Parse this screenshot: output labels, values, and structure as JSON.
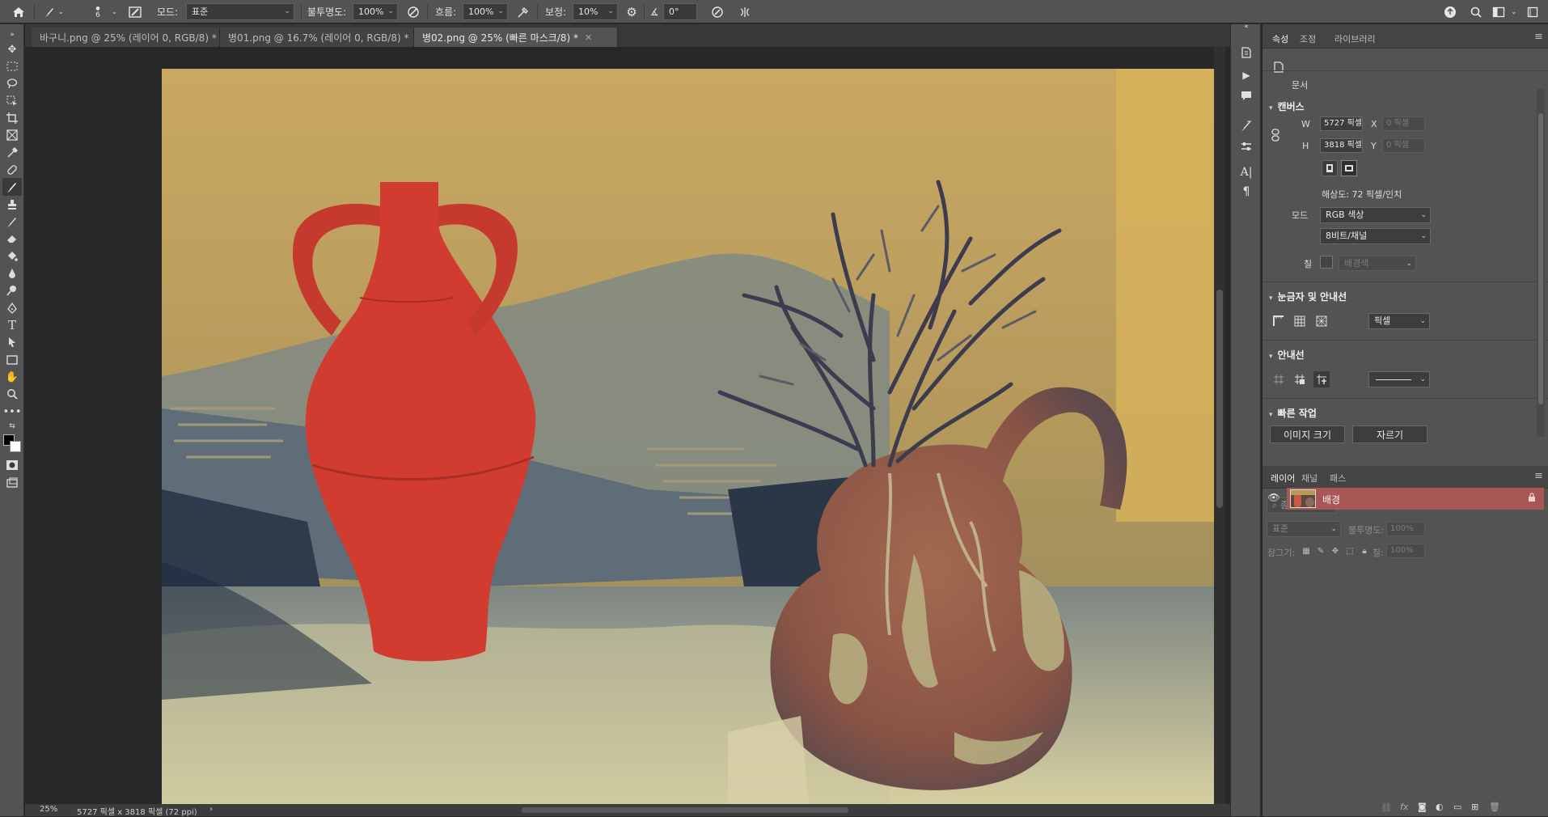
{
  "options_bar": {
    "home_icon": "home-icon",
    "brush_size": "6",
    "mode_label": "모드:",
    "mode_value": "표준",
    "opacity_label": "불투명도:",
    "opacity_value": "100%",
    "flow_label": "흐름:",
    "flow_value": "100%",
    "smoothing_label": "보정:",
    "smoothing_value": "10%",
    "angle_value": "0°"
  },
  "tabs": [
    {
      "label": "바구니.png @ 25% (레이어 0, RGB/8) *"
    },
    {
      "label": "병01.png @ 16.7% (레이어 0, RGB/8) *"
    },
    {
      "label": "병02.png @ 25% (빠른 마스크/8) *"
    }
  ],
  "status": {
    "zoom": "25%",
    "doc_info": "5727 픽셀 x 3818 픽셀 (72 ppi)"
  },
  "properties": {
    "tabs": [
      "속성",
      "조정",
      "라이브러리"
    ],
    "doc_label": "문서",
    "canvas_title": "캔버스",
    "w_label": "W",
    "w_value": "5727 픽셀",
    "h_label": "H",
    "h_value": "3818 픽셀",
    "x_label": "X",
    "x_placeholder": "0 픽셀",
    "y_label": "Y",
    "y_placeholder": "0 픽셀",
    "resolution": "해상도: 72 픽셀/인치",
    "mode_label": "모드",
    "mode_value": "RGB 색상",
    "bit_value": "8비트/채널",
    "fill_label": "칠",
    "fill_value": "배경색",
    "rulers_title": "눈금자 및 안내선",
    "ruler_unit": "픽셀",
    "guides_title": "안내선",
    "quick_title": "빠른 작업",
    "image_size_btn": "이미지 크기",
    "crop_btn": "자르기"
  },
  "layers": {
    "tabs": [
      "레이어",
      "채널",
      "패스"
    ],
    "filter_label": "종류",
    "blend_value": "표준",
    "opacity_label": "불투명도:",
    "opacity_value": "100%",
    "lock_label": "잠그기:",
    "fill_label": "칠:",
    "fill_value": "100%",
    "items": [
      {
        "name": "배경"
      }
    ]
  },
  "colors": {
    "ui_bg": "#535353",
    "mask_red": "#d23c30",
    "selected_layer": "#a95656"
  }
}
